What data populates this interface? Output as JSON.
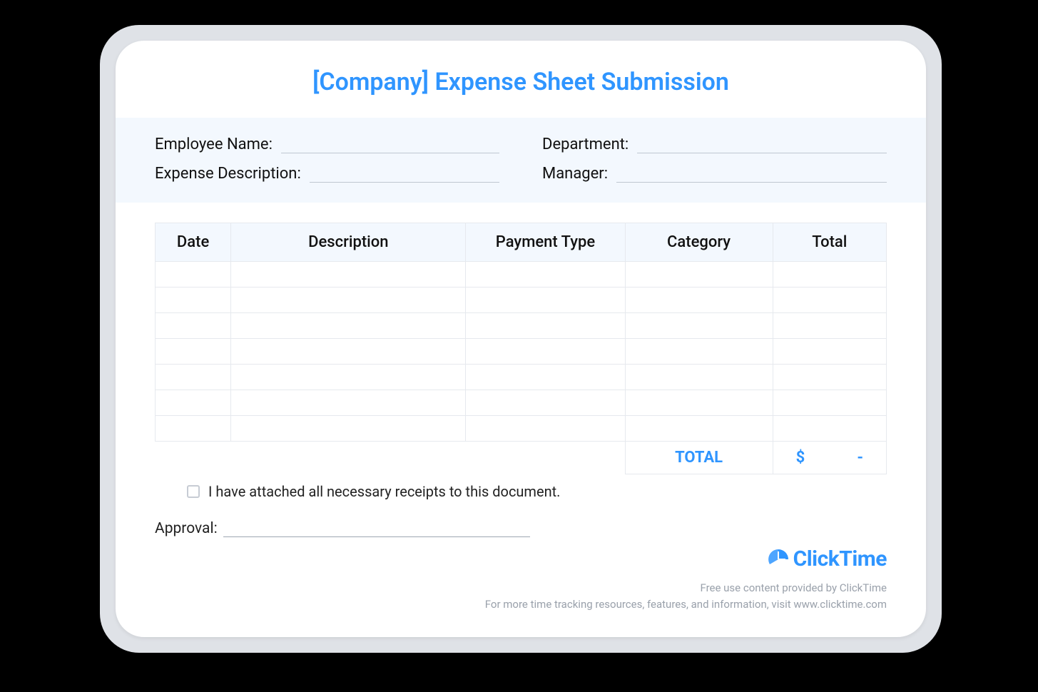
{
  "title": "[Company] Expense Sheet Submission",
  "info": {
    "employee_name_label": "Employee Name:",
    "department_label": "Department:",
    "expense_description_label": "Expense Description:",
    "manager_label": "Manager:"
  },
  "table": {
    "headers": {
      "date": "Date",
      "description": "Description",
      "payment_type": "Payment Type",
      "category": "Category",
      "total": "Total"
    },
    "row_count": 7,
    "total_label": "TOTAL",
    "total_currency": "$",
    "total_value": "-"
  },
  "receipts_checkbox_label": "I have attached all necessary receipts to this document.",
  "approval_label": "Approval:",
  "logo_text": "ClickTime",
  "footer_line1": "Free use content provided by ClickTime",
  "footer_line2": "For more time tracking resources, features, and information, visit www.clicktime.com"
}
